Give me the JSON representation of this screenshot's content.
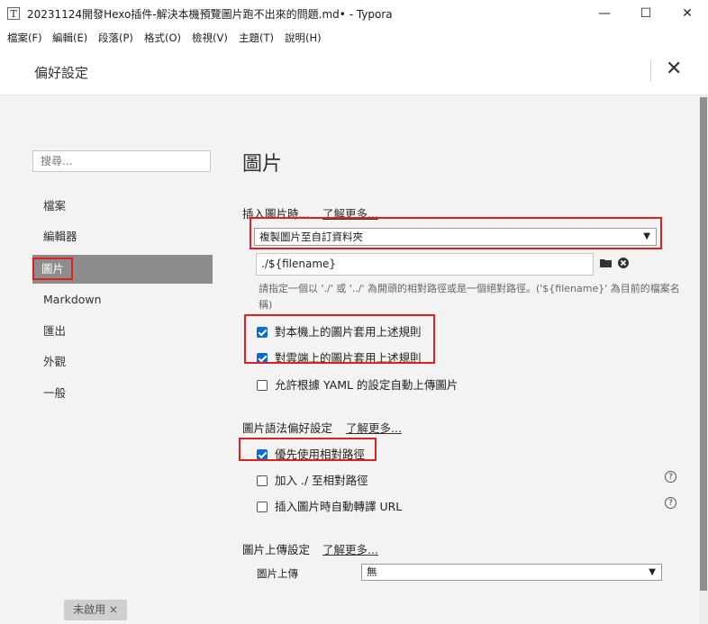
{
  "window": {
    "app_icon_glyph": "T",
    "title": "20231124開發Hexo插件-解決本機預覽圖片跑不出來的問題.md• - Typora",
    "minimize_glyph": "—",
    "maximize_glyph": "☐",
    "close_glyph": "✕"
  },
  "menubar": {
    "items": [
      "檔案(F)",
      "編輯(E)",
      "段落(P)",
      "格式(O)",
      "檢視(V)",
      "主題(T)",
      "說明(H)"
    ]
  },
  "header": {
    "title": "偏好設定",
    "close_glyph": "✕"
  },
  "sidebar": {
    "search_placeholder": "搜尋...",
    "items": [
      {
        "label": "檔案",
        "active": false
      },
      {
        "label": "編輯器",
        "active": false
      },
      {
        "label": "圖片",
        "active": true
      },
      {
        "label": "Markdown",
        "active": false
      },
      {
        "label": "匯出",
        "active": false
      },
      {
        "label": "外觀",
        "active": false
      },
      {
        "label": "一般",
        "active": false
      }
    ]
  },
  "main": {
    "heading": "圖片",
    "insert": {
      "label": "插入圖片時...",
      "learn_more": "了解更多...",
      "action_value": "複製圖片至自訂資料夾",
      "path_value": "./${filename}",
      "folder_icon": "folder-icon",
      "clear_icon": "clear-icon",
      "hint": "請指定一個以 './' 或 '../' 為開頭的相對路徑或是一個絕對路徑。('${filename}' 為目前的檔案名稱)",
      "options": [
        {
          "label": "對本機上的圖片套用上述規則",
          "checked": true
        },
        {
          "label": "對雲端上的圖片套用上述規則",
          "checked": true
        },
        {
          "label": "允許根據 YAML 的設定自動上傳圖片",
          "checked": false
        }
      ]
    },
    "syntax": {
      "label": "圖片語法偏好設定",
      "learn_more": "了解更多...",
      "options": [
        {
          "label": "優先使用相對路徑",
          "checked": true
        },
        {
          "label": "加入 ./ 至相對路徑",
          "checked": false
        },
        {
          "label": "插入圖片時自動轉譯 URL",
          "checked": false
        }
      ]
    },
    "upload": {
      "label": "圖片上傳設定",
      "learn_more": "了解更多...",
      "uploader_label": "圖片上傳",
      "uploader_value": "無"
    }
  },
  "status": {
    "badge": "未啟用 ×"
  },
  "colors": {
    "highlight": "#e02020",
    "checkbox": "#0b6ccf",
    "active_nav": "#8c8c8c"
  }
}
